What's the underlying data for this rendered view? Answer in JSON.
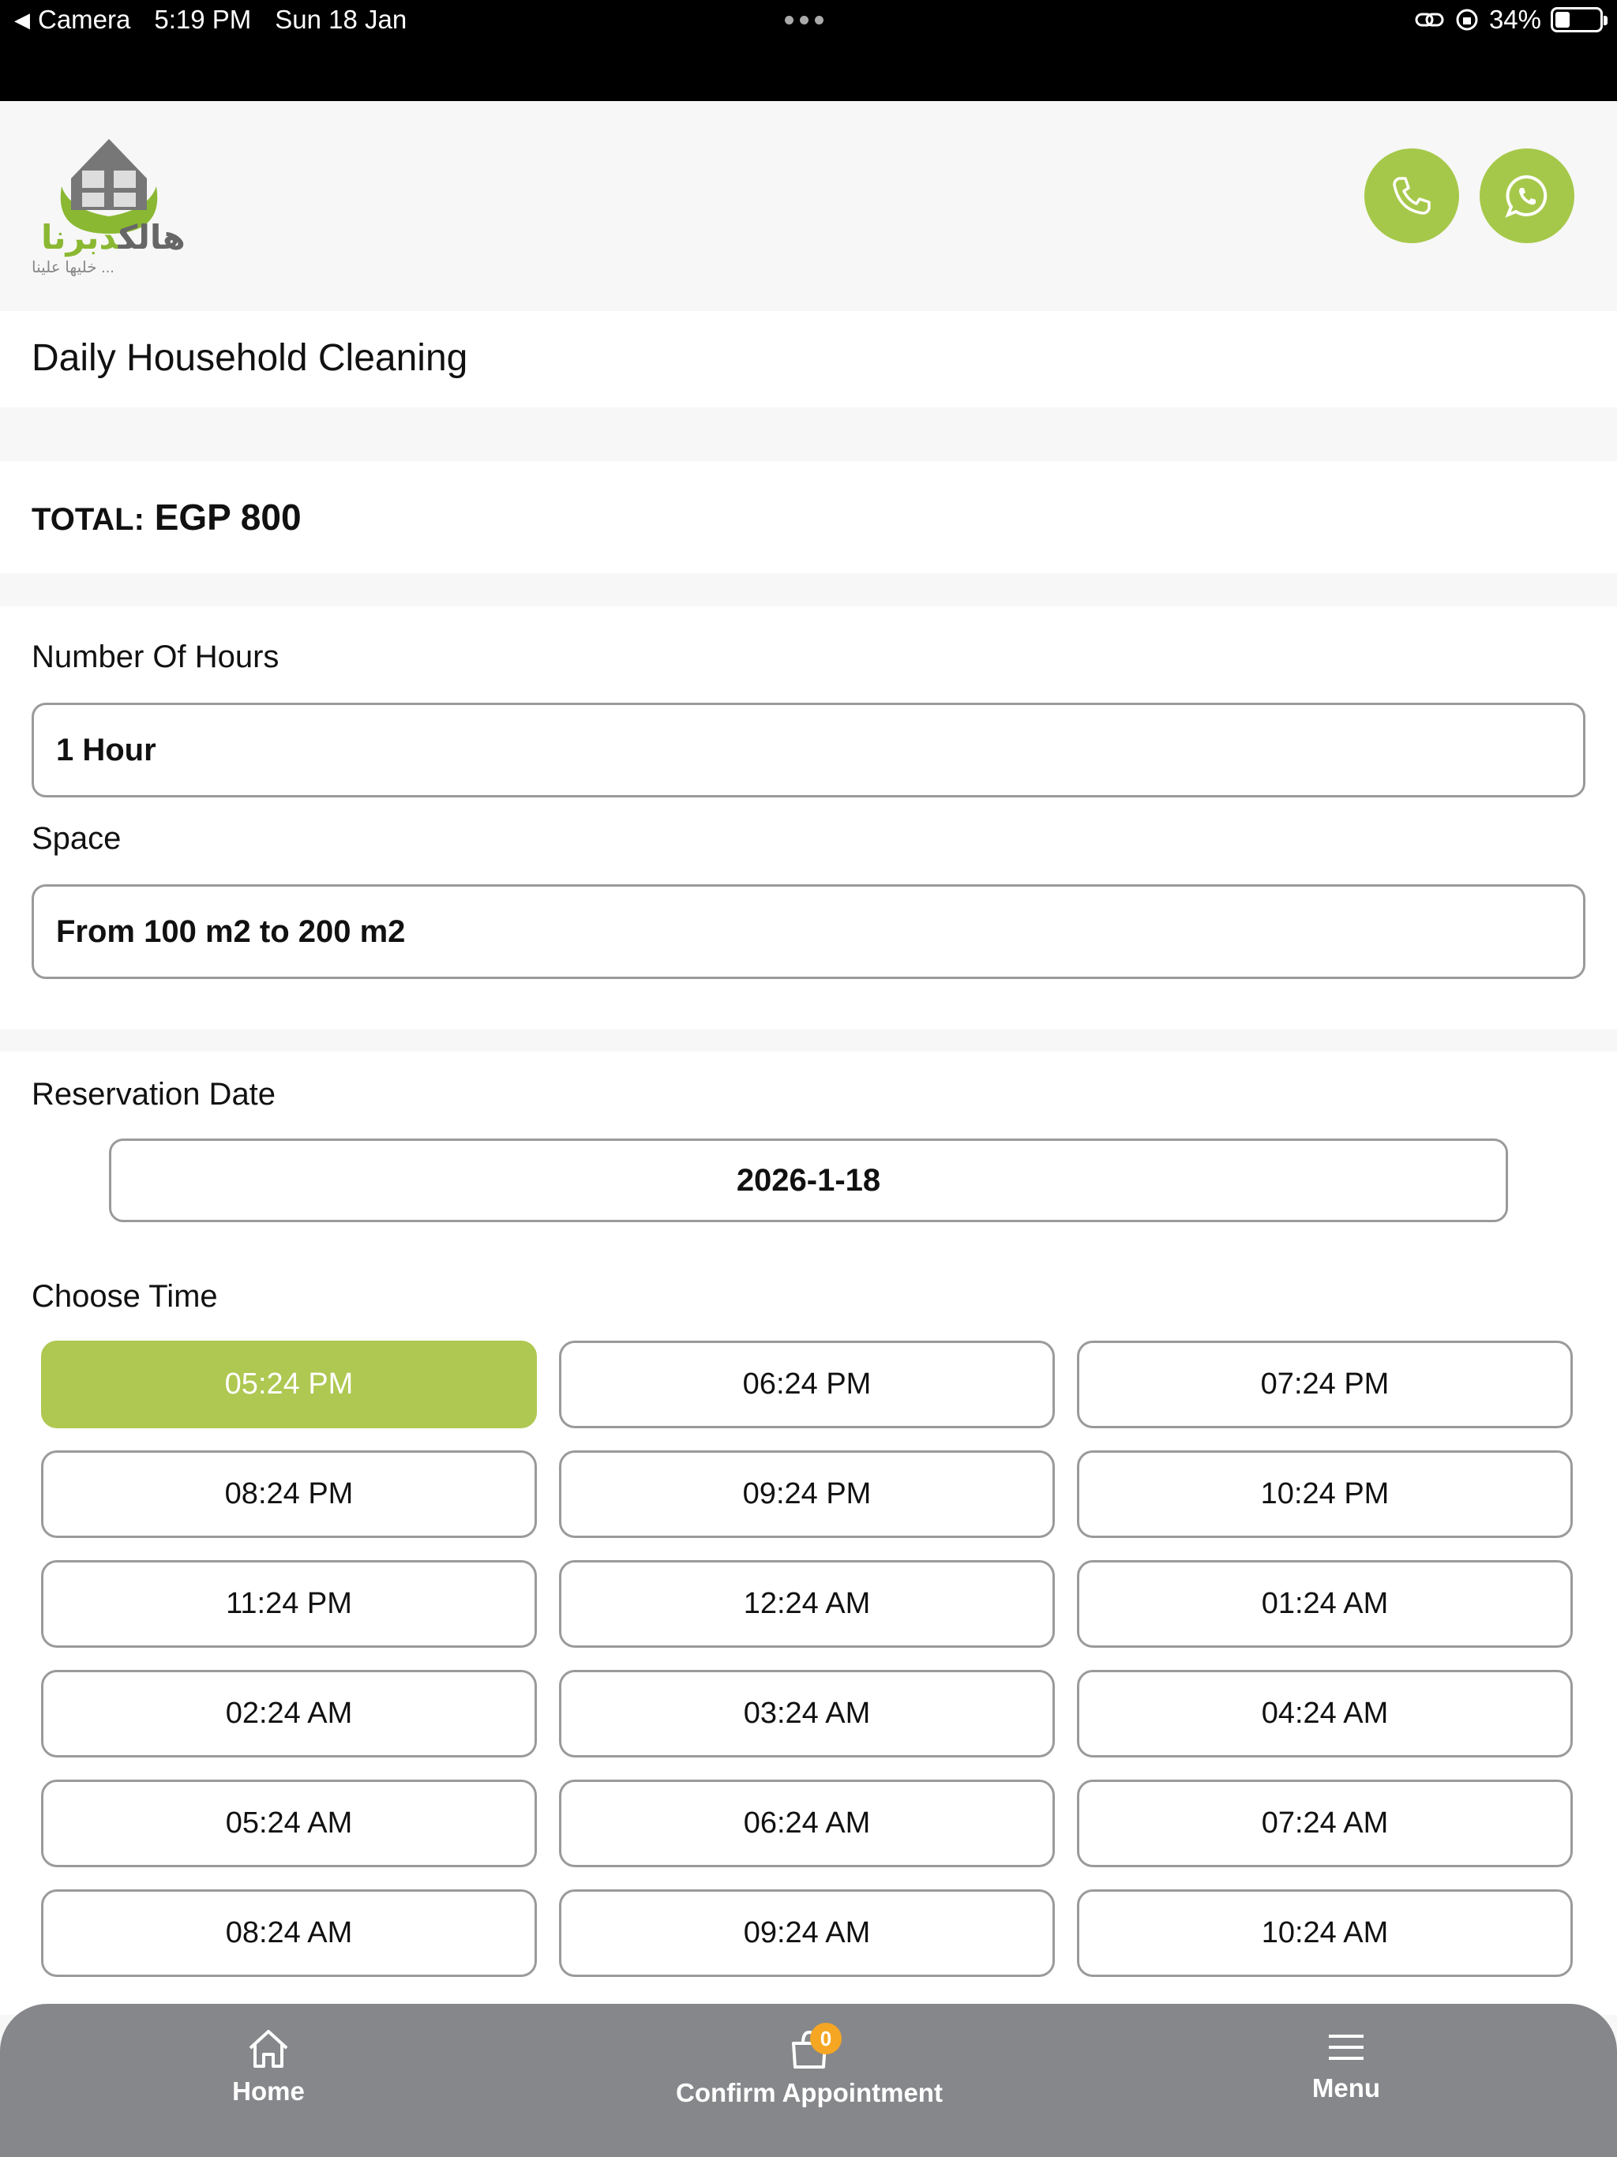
{
  "status_bar": {
    "back_app": "Camera",
    "time": "5:19 PM",
    "date": "Sun 18 Jan",
    "battery": "34%",
    "battery_level": 0.34
  },
  "header": {
    "logo_text_green": "دبرنا",
    "logo_text_dark": "هالك",
    "logo_tagline": "خليها علينا ...",
    "brand_color": "#a6c84a"
  },
  "service": {
    "title": "Daily Household Cleaning"
  },
  "total": {
    "label": "TOTAL:",
    "value": "EGP 800"
  },
  "form": {
    "hours_label": "Number Of Hours",
    "hours_value": "1 Hour",
    "space_label": "Space",
    "space_value": "From 100 m2 to 200 m2"
  },
  "reservation": {
    "date_label": "Reservation Date",
    "date_value": "2026-1-18",
    "time_label": "Choose Time",
    "selected_index": 0,
    "times": [
      "05:24 PM",
      "06:24 PM",
      "07:24 PM",
      "08:24 PM",
      "09:24 PM",
      "10:24 PM",
      "11:24 PM",
      "12:24 AM",
      "01:24 AM",
      "02:24 AM",
      "03:24 AM",
      "04:24 AM",
      "05:24 AM",
      "06:24 AM",
      "07:24 AM",
      "08:24 AM",
      "09:24 AM",
      "10:24 AM"
    ]
  },
  "bottom_nav": {
    "home": "Home",
    "confirm": "Confirm Appointment",
    "confirm_badge": "0",
    "menu": "Menu"
  }
}
